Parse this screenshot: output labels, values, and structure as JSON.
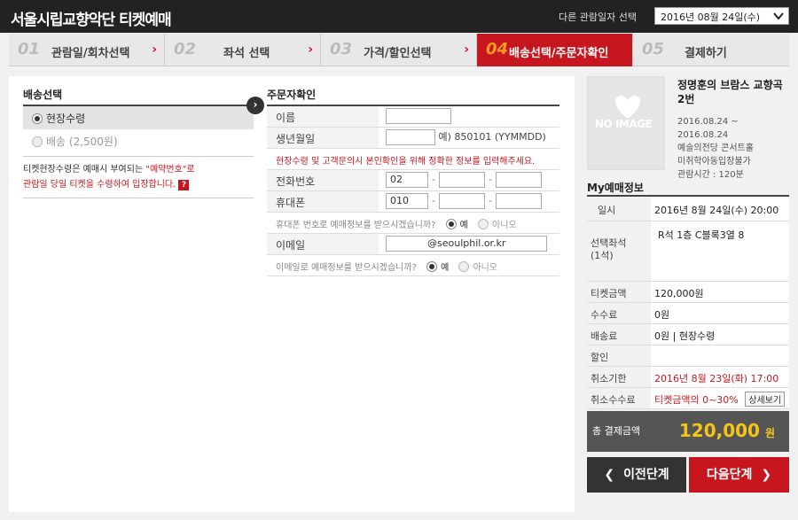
{
  "header": {
    "title": "서울시립교향악단 티켓예매",
    "other_date_label": "다른 관람일자 선택",
    "date_select_value": "2016년 08월 24일(수)"
  },
  "steps": [
    {
      "num": "01",
      "label": "관람일/회차선택"
    },
    {
      "num": "02",
      "label": "좌석 선택"
    },
    {
      "num": "03",
      "label": "가격/할인선택"
    },
    {
      "num": "04",
      "label": "배송선택/주문자확인"
    },
    {
      "num": "05",
      "label": "결제하기"
    }
  ],
  "delivery": {
    "title": "배송선택",
    "option1": "현장수령",
    "option2": "배송 (2,500원)",
    "note_line1_a": "티켓현장수령은 예매시 부여되는 ",
    "note_line1_b": "\"예약번호\"로",
    "note_line2": "관람일 당일 티켓을 수령하여 입장합니다.",
    "help_mark": "?"
  },
  "orderer": {
    "title": "주문자확인",
    "name_label": "이름",
    "name_value": "",
    "birth_label": "생년월일",
    "birth_value": "",
    "birth_hint": "예) 850101 (YYMMDD)",
    "notice": "현장수령 및 고객문의시 본인확인을 위해 정확한 정보를 입력해주세요.",
    "phone_label": "전화번호",
    "phone_1": "02",
    "phone_2": "",
    "phone_3": "",
    "mobile_label": "휴대폰",
    "mobile_1": "010",
    "mobile_2": "",
    "mobile_3": "",
    "sms_question": "휴대폰 번호로 예매정보를 받으시겠습니까?",
    "yes": "예",
    "no": "아니오",
    "email_label": "이메일",
    "email_value": "@seoulphil.or.kr",
    "email_question": "이메일로 예매정보를 받으시겠습니까?"
  },
  "performance": {
    "poster_text": "NO IMAGE",
    "title": "정명훈의 브람스 교향곡 2번",
    "period": "2016.08.24 ~ 2016.08.24",
    "venue": "예술의전당 콘서트홀",
    "age": "미취학아동입장불가",
    "duration": "관람시간 : 120분"
  },
  "summary": {
    "title": "My예매정보",
    "date_label": "일시",
    "date_value": "2016년 8월 24일(수) 20:00",
    "seat_label": "선택좌석",
    "seat_count": "(1석)",
    "seat_value": "R석 1층 C블록3열 8",
    "ticket_label": "티켓금액",
    "ticket_value": "120,000원",
    "fee_label": "수수료",
    "fee_value": "0원",
    "delivery_label": "배송료",
    "delivery_value": "0원 | 현장수령",
    "discount_label": "할인",
    "discount_value": "",
    "cancel_deadline_label": "취소기한",
    "cancel_deadline_value": "2016년 8월 23일(화) 17:00",
    "cancel_fee_label": "취소수수료",
    "cancel_fee_value": "티켓금액의 0~30%",
    "detail_button": "상세보기",
    "total_label": "총 결제금액",
    "total_value": "120,000",
    "total_unit": "원"
  },
  "buttons": {
    "prev": "이전단계",
    "next": "다음단계"
  }
}
